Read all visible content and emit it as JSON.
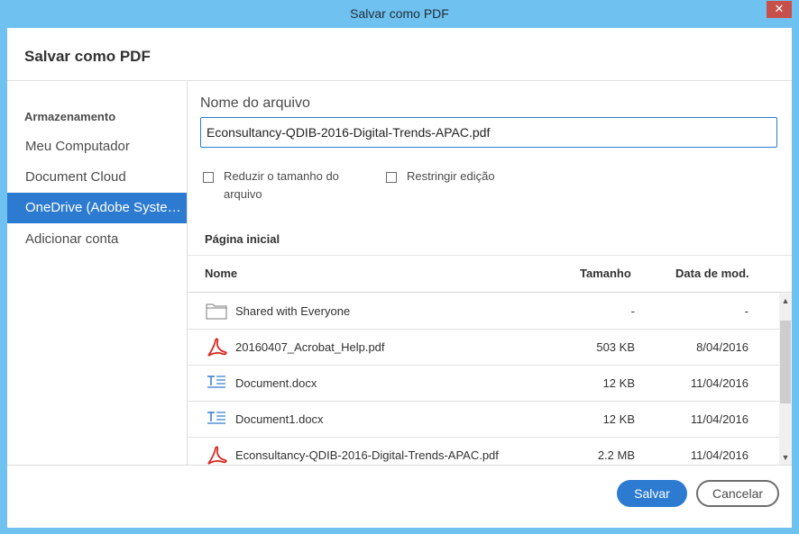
{
  "window": {
    "title": "Salvar como PDF",
    "close_label": "✕"
  },
  "dialog": {
    "heading": "Salvar como PDF"
  },
  "sidebar": {
    "section_label": "Armazenamento",
    "items": [
      {
        "label": "Meu Computador",
        "active": false
      },
      {
        "label": "Document Cloud",
        "active": false
      },
      {
        "label": "OneDrive (Adobe Systems)",
        "active": true
      },
      {
        "label": "Adicionar conta",
        "active": false
      }
    ]
  },
  "form": {
    "filename_label": "Nome do arquivo",
    "filename_value": "Econsultancy-QDIB-2016-Digital-Trends-APAC.pdf",
    "reduce_size_label_line1": "Reduzir o tamanho do",
    "reduce_size_label_line2": "arquivo",
    "restrict_label": "Restringir edição"
  },
  "browser": {
    "location_label": "Página inicial",
    "columns": {
      "name": "Nome",
      "size": "Tamanho",
      "date": "Data de mod."
    },
    "rows": [
      {
        "icon": "folder-icon",
        "name": "Shared with Everyone",
        "size": "-",
        "date": "-"
      },
      {
        "icon": "pdf-icon",
        "name": "20160407_Acrobat_Help.pdf",
        "size": "503 KB",
        "date": "8/04/2016"
      },
      {
        "icon": "docx-icon",
        "name": "Document.docx",
        "size": "12 KB",
        "date": "11/04/2016"
      },
      {
        "icon": "docx-icon",
        "name": "Document1.docx",
        "size": "12 KB",
        "date": "11/04/2016"
      },
      {
        "icon": "pdf-icon",
        "name": "Econsultancy-QDIB-2016-Digital-Trends-APAC.pdf",
        "size": "2.2 MB",
        "date": "11/04/2016"
      }
    ]
  },
  "buttons": {
    "save": "Salvar",
    "cancel": "Cancelar"
  },
  "colors": {
    "accent": "#2d7bd0",
    "titlebar": "#6fc1ef",
    "close": "#c7514a",
    "pdf": "#d9271e",
    "docx": "#2d7bd0"
  }
}
